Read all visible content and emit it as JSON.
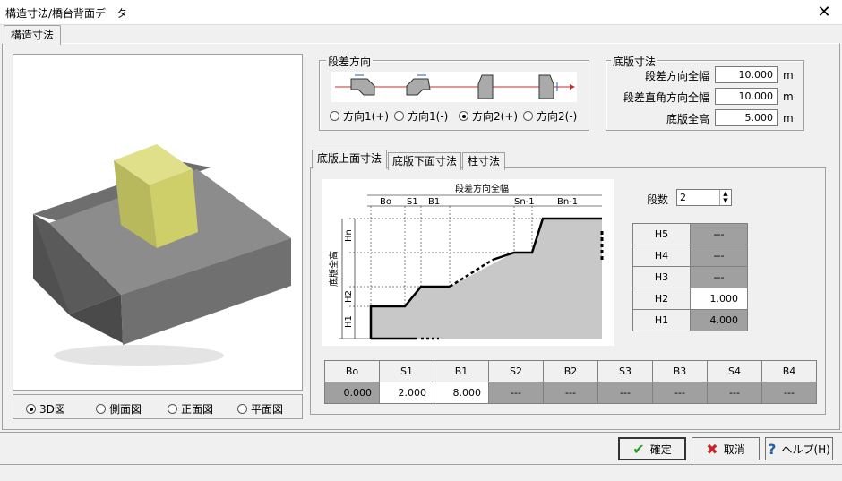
{
  "window": {
    "title": "構造寸法/橋台背面データ",
    "close": "✕"
  },
  "main_tab": "構造寸法",
  "view_options": [
    "3D図",
    "側面図",
    "正面図",
    "平面図"
  ],
  "view_selected": "3D図",
  "step_direction": {
    "title": "段差方向",
    "options": [
      "方向1(+)",
      "方向1(-)",
      "方向2(+)",
      "方向2(-)"
    ],
    "selected": "方向2(+)"
  },
  "slab": {
    "title": "底版寸法",
    "rows": [
      {
        "label": "段差方向全幅",
        "value": "10.000",
        "unit": "m"
      },
      {
        "label": "段差直角方向全幅",
        "value": "10.000",
        "unit": "m"
      },
      {
        "label": "底版全高",
        "value": "5.000",
        "unit": "m"
      }
    ]
  },
  "sub_tabs": [
    "底版上面寸法",
    "底版下面寸法",
    "柱寸法"
  ],
  "diagram": {
    "top": "段差方向全幅",
    "bo": "Bo",
    "s1": "S1",
    "b1": "B1",
    "sn": "Sn-1",
    "bn": "Bn-1",
    "side": "底版全高",
    "hn": "Hn",
    "h2": "H2",
    "h1": "H1"
  },
  "steps": {
    "label": "段数",
    "value": "2"
  },
  "heights": [
    {
      "label": "H5",
      "value": "---",
      "state": "gray"
    },
    {
      "label": "H4",
      "value": "---",
      "state": "gray"
    },
    {
      "label": "H3",
      "value": "---",
      "state": "gray"
    },
    {
      "label": "H2",
      "value": "1.000",
      "state": "white"
    },
    {
      "label": "H1",
      "value": "4.000",
      "state": "gray"
    }
  ],
  "widths": {
    "headers": [
      "Bo",
      "S1",
      "B1",
      "S2",
      "B2",
      "S3",
      "B3",
      "S4",
      "B4"
    ],
    "values": [
      "0.000",
      "2.000",
      "8.000",
      "---",
      "---",
      "---",
      "---",
      "---",
      "---"
    ],
    "states": [
      "gray",
      "white",
      "white",
      "gray",
      "gray",
      "gray",
      "gray",
      "gray",
      "gray"
    ]
  },
  "buttons": {
    "ok": "確定",
    "cancel": "取消",
    "help": "ヘルプ(H)"
  },
  "colors": {
    "block": "#c8c86a",
    "slab": "#8c8c8c",
    "ok": "#2e9c2e",
    "cancel": "#c0282d",
    "help": "#1f5fb0"
  }
}
